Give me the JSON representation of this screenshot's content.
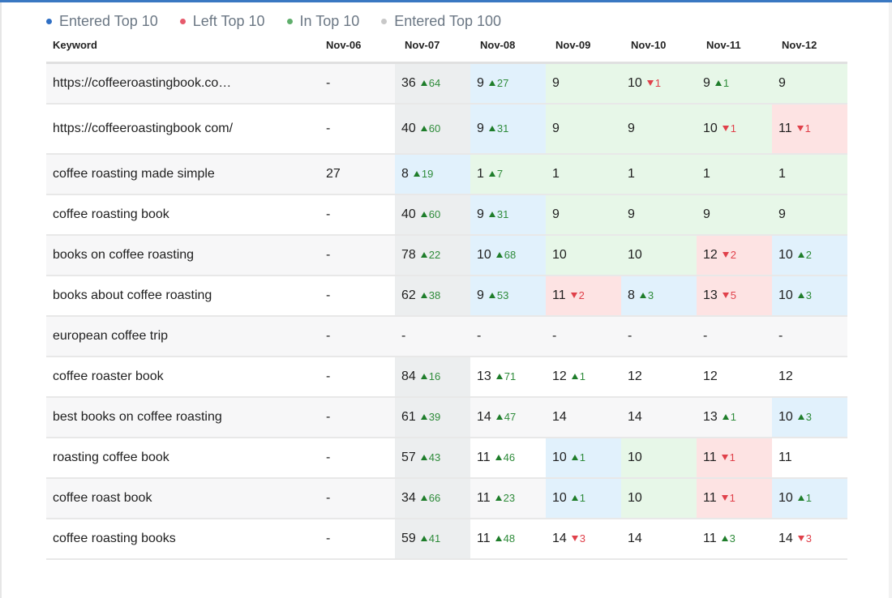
{
  "legend": [
    {
      "label": "Entered Top 10",
      "color": "#2f6fc4",
      "icon": "dot"
    },
    {
      "label": "Left Top 10",
      "color": "#e65a6c",
      "icon": "dot"
    },
    {
      "label": "In Top 10",
      "color": "#5fae6c",
      "icon": "dot"
    },
    {
      "label": "Entered Top 100",
      "color": "#c8c8c8",
      "icon": "dot"
    }
  ],
  "table": {
    "keyword_header": "Keyword",
    "date_headers": [
      "Nov-06",
      "Nov-07",
      "Nov-08",
      "Nov-09",
      "Nov-10",
      "Nov-11",
      "Nov-12"
    ],
    "state_legend": {
      "g": "Entered Top 100",
      "b": "Entered Top 10",
      "n": "In Top 10",
      "r": "Left Top 10"
    },
    "rows": [
      {
        "keyword": "https://coffeeroastingbook.co…",
        "cells": [
          {
            "v": "-",
            "s": ""
          },
          {
            "v": "36",
            "d": "up",
            "c": "64",
            "s": "g"
          },
          {
            "v": "9",
            "d": "up",
            "c": "27",
            "s": "b"
          },
          {
            "v": "9",
            "s": "n"
          },
          {
            "v": "10",
            "d": "down",
            "c": "1",
            "s": "n"
          },
          {
            "v": "9",
            "d": "up",
            "c": "1",
            "s": "n"
          },
          {
            "v": "9",
            "s": "n"
          }
        ]
      },
      {
        "keyword": "https://coffeeroastingbook com/",
        "tall": true,
        "cells": [
          {
            "v": "-",
            "s": ""
          },
          {
            "v": "40",
            "d": "up",
            "c": "60",
            "s": "g"
          },
          {
            "v": "9",
            "d": "up",
            "c": "31",
            "s": "b"
          },
          {
            "v": "9",
            "s": "n"
          },
          {
            "v": "9",
            "s": "n"
          },
          {
            "v": "10",
            "d": "down",
            "c": "1",
            "s": "n"
          },
          {
            "v": "11",
            "d": "down",
            "c": "1",
            "s": "r"
          }
        ]
      },
      {
        "keyword": "coffee roasting made simple",
        "cells": [
          {
            "v": "27",
            "s": ""
          },
          {
            "v": "8",
            "d": "up",
            "c": "19",
            "s": "b"
          },
          {
            "v": "1",
            "d": "up",
            "c": "7",
            "s": "n"
          },
          {
            "v": "1",
            "s": "n"
          },
          {
            "v": "1",
            "s": "n"
          },
          {
            "v": "1",
            "s": "n"
          },
          {
            "v": "1",
            "s": "n"
          }
        ]
      },
      {
        "keyword": "coffee roasting book",
        "cells": [
          {
            "v": "-",
            "s": ""
          },
          {
            "v": "40",
            "d": "up",
            "c": "60",
            "s": "g"
          },
          {
            "v": "9",
            "d": "up",
            "c": "31",
            "s": "b"
          },
          {
            "v": "9",
            "s": "n"
          },
          {
            "v": "9",
            "s": "n"
          },
          {
            "v": "9",
            "s": "n"
          },
          {
            "v": "9",
            "s": "n"
          }
        ]
      },
      {
        "keyword": "books on coffee roasting",
        "cells": [
          {
            "v": "-",
            "s": ""
          },
          {
            "v": "78",
            "d": "up",
            "c": "22",
            "s": "g"
          },
          {
            "v": "10",
            "d": "up",
            "c": "68",
            "s": "b"
          },
          {
            "v": "10",
            "s": "n"
          },
          {
            "v": "10",
            "s": "n"
          },
          {
            "v": "12",
            "d": "down",
            "c": "2",
            "s": "r"
          },
          {
            "v": "10",
            "d": "up",
            "c": "2",
            "s": "b"
          }
        ]
      },
      {
        "keyword": "books about coffee roasting",
        "cells": [
          {
            "v": "-",
            "s": ""
          },
          {
            "v": "62",
            "d": "up",
            "c": "38",
            "s": "g"
          },
          {
            "v": "9",
            "d": "up",
            "c": "53",
            "s": "b"
          },
          {
            "v": "11",
            "d": "down",
            "c": "2",
            "s": "r"
          },
          {
            "v": "8",
            "d": "up",
            "c": "3",
            "s": "b"
          },
          {
            "v": "13",
            "d": "down",
            "c": "5",
            "s": "r"
          },
          {
            "v": "10",
            "d": "up",
            "c": "3",
            "s": "b"
          }
        ]
      },
      {
        "keyword": "european coffee trip",
        "cells": [
          {
            "v": "-",
            "s": ""
          },
          {
            "v": "-",
            "s": ""
          },
          {
            "v": "-",
            "s": ""
          },
          {
            "v": "-",
            "s": ""
          },
          {
            "v": "-",
            "s": ""
          },
          {
            "v": "-",
            "s": ""
          },
          {
            "v": "-",
            "s": ""
          }
        ]
      },
      {
        "keyword": "coffee roaster book",
        "cells": [
          {
            "v": "-",
            "s": ""
          },
          {
            "v": "84",
            "d": "up",
            "c": "16",
            "s": "g"
          },
          {
            "v": "13",
            "d": "up",
            "c": "71",
            "s": ""
          },
          {
            "v": "12",
            "d": "up",
            "c": "1",
            "s": ""
          },
          {
            "v": "12",
            "s": ""
          },
          {
            "v": "12",
            "s": ""
          },
          {
            "v": "12",
            "s": ""
          }
        ]
      },
      {
        "keyword": "best books on coffee roasting",
        "cells": [
          {
            "v": "-",
            "s": ""
          },
          {
            "v": "61",
            "d": "up",
            "c": "39",
            "s": "g"
          },
          {
            "v": "14",
            "d": "up",
            "c": "47",
            "s": ""
          },
          {
            "v": "14",
            "s": ""
          },
          {
            "v": "14",
            "s": ""
          },
          {
            "v": "13",
            "d": "up",
            "c": "1",
            "s": ""
          },
          {
            "v": "10",
            "d": "up",
            "c": "3",
            "s": "b"
          }
        ]
      },
      {
        "keyword": "roasting coffee book",
        "cells": [
          {
            "v": "-",
            "s": ""
          },
          {
            "v": "57",
            "d": "up",
            "c": "43",
            "s": "g"
          },
          {
            "v": "11",
            "d": "up",
            "c": "46",
            "s": ""
          },
          {
            "v": "10",
            "d": "up",
            "c": "1",
            "s": "b"
          },
          {
            "v": "10",
            "s": "n"
          },
          {
            "v": "11",
            "d": "down",
            "c": "1",
            "s": "r"
          },
          {
            "v": "11",
            "s": ""
          }
        ]
      },
      {
        "keyword": "coffee roast book",
        "cells": [
          {
            "v": "-",
            "s": ""
          },
          {
            "v": "34",
            "d": "up",
            "c": "66",
            "s": "g"
          },
          {
            "v": "11",
            "d": "up",
            "c": "23",
            "s": ""
          },
          {
            "v": "10",
            "d": "up",
            "c": "1",
            "s": "b"
          },
          {
            "v": "10",
            "s": "n"
          },
          {
            "v": "11",
            "d": "down",
            "c": "1",
            "s": "r"
          },
          {
            "v": "10",
            "d": "up",
            "c": "1",
            "s": "b"
          }
        ]
      },
      {
        "keyword": "coffee roasting books",
        "cells": [
          {
            "v": "-",
            "s": ""
          },
          {
            "v": "59",
            "d": "up",
            "c": "41",
            "s": "g"
          },
          {
            "v": "11",
            "d": "up",
            "c": "48",
            "s": ""
          },
          {
            "v": "14",
            "d": "down",
            "c": "3",
            "s": ""
          },
          {
            "v": "14",
            "s": ""
          },
          {
            "v": "11",
            "d": "up",
            "c": "3",
            "s": ""
          },
          {
            "v": "14",
            "d": "down",
            "c": "3",
            "s": ""
          }
        ]
      }
    ]
  }
}
